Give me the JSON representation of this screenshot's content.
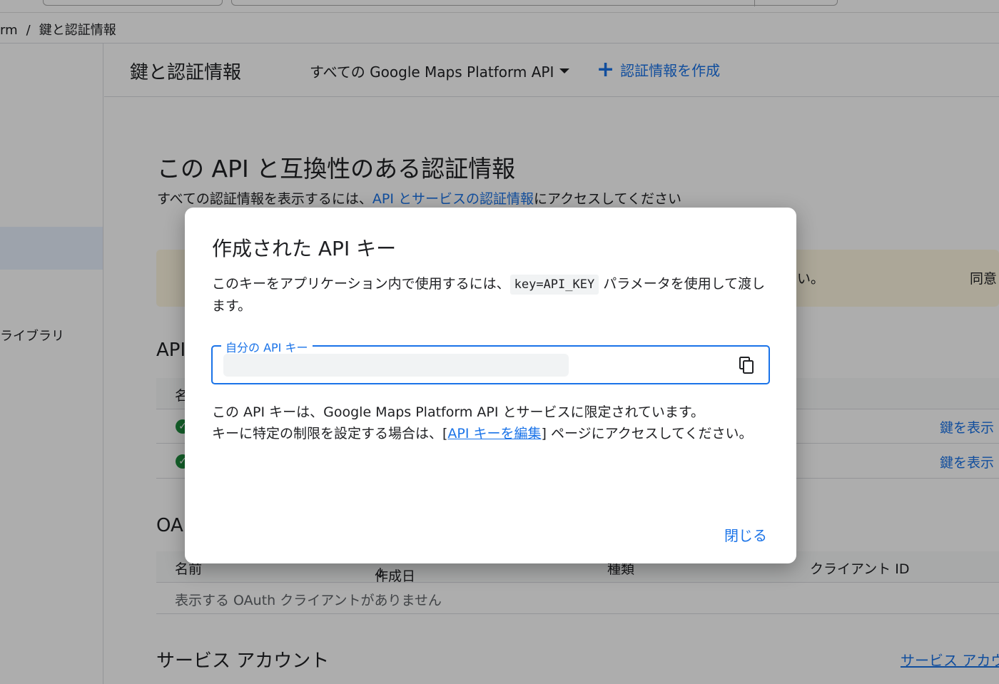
{
  "breadcrumb": {
    "parent": "rm",
    "separator": "/",
    "current": "鍵と認証情報"
  },
  "sidebar": {
    "library_label": "ライブラリ"
  },
  "header": {
    "title": "鍵と認証情報",
    "api_filter": "すべての Google Maps Platform API",
    "create_label": "認証情報を作成"
  },
  "main": {
    "heading": "この API と互換性のある認証情報",
    "desc_prefix": "すべての認証情報を表示するには、",
    "desc_link": "API とサービスの認証情報",
    "desc_suffix": "にアクセスしてください",
    "banner_text": "い。",
    "banner_action": "同意"
  },
  "api_keys_section": {
    "heading": "API",
    "column_name": "名",
    "rows": [
      {
        "show_key_label": "鍵を表示"
      },
      {
        "show_key_label": "鍵を表示"
      }
    ]
  },
  "oauth_section": {
    "heading": "OA",
    "columns": [
      "名前",
      "作成日",
      "種類",
      "クライアント ID"
    ],
    "empty_text": "表示する OAuth クライアントがありません"
  },
  "service_accounts": {
    "heading": "サービス アカウント",
    "link": "サービス アカウ"
  },
  "dialog": {
    "title": "作成された API キー",
    "text_before": "このキーをアプリケーション内で使用するには、",
    "code": "key=API_KEY",
    "text_after": " パラメータを使用して渡します。",
    "field_label": "自分の API キー",
    "note_line1": "この API キーは、Google Maps Platform API とサービスに限定されています。",
    "note_prefix": "キーに特定の制限を設定する場合は、[",
    "note_link": "API キーを編集",
    "note_suffix": "] ページにアクセスしてください。",
    "close_label": "閉じる"
  },
  "colors": {
    "accent": "#1a73e8",
    "success": "#1e8e3e",
    "banner": "#fef7e0"
  }
}
